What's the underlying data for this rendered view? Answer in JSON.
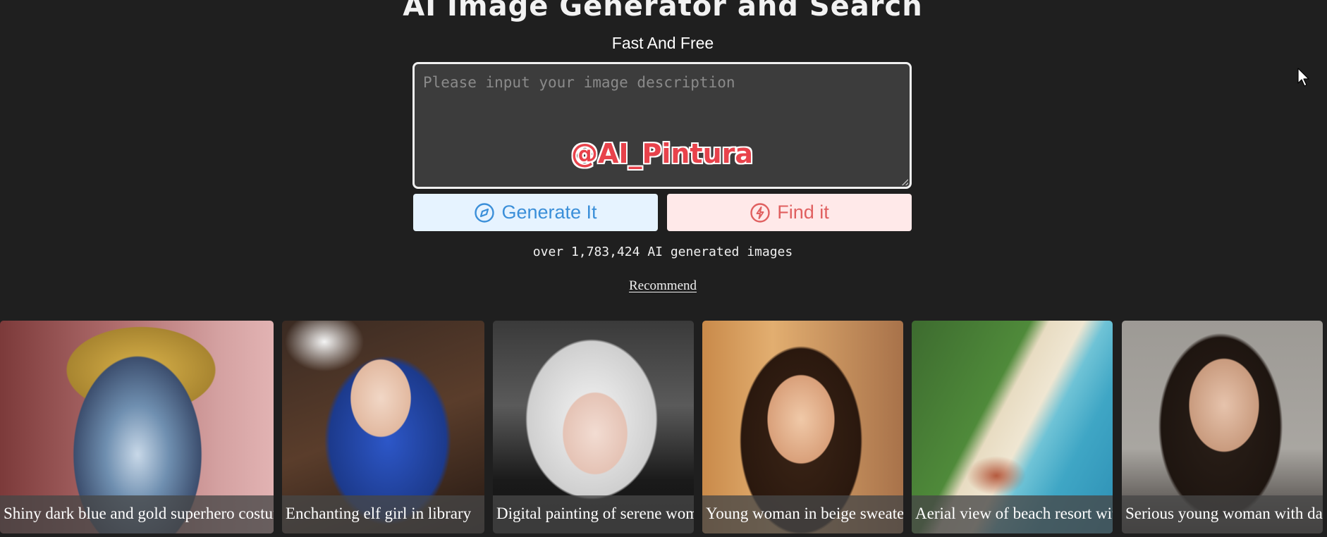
{
  "header": {
    "title": "AI Image Generator and Search",
    "subtitle": "Fast And Free"
  },
  "prompt": {
    "placeholder": "Please input your image description",
    "value": "",
    "watermark": "@AI_Pintura"
  },
  "buttons": {
    "generate_label": "Generate It",
    "generate_icon": "compass-icon",
    "find_label": "Find it",
    "find_icon": "lightning-icon"
  },
  "stats": {
    "count_text": "over 1,783,424 AI generated images"
  },
  "section": {
    "recommend_label": "Recommend"
  },
  "gallery": {
    "items": [
      {
        "caption": "Shiny dark blue and gold superhero costume"
      },
      {
        "caption": "Enchanting elf girl in library"
      },
      {
        "caption": "Digital painting of serene woman"
      },
      {
        "caption": "Young woman in beige sweater"
      },
      {
        "caption": "Aerial view of beach resort with"
      },
      {
        "caption": "Serious young woman with dark hair"
      }
    ]
  },
  "colors": {
    "background": "#1f1f1f",
    "generate_accent": "#3b8fd9",
    "find_accent": "#e06060",
    "watermark": "#e8424b"
  }
}
